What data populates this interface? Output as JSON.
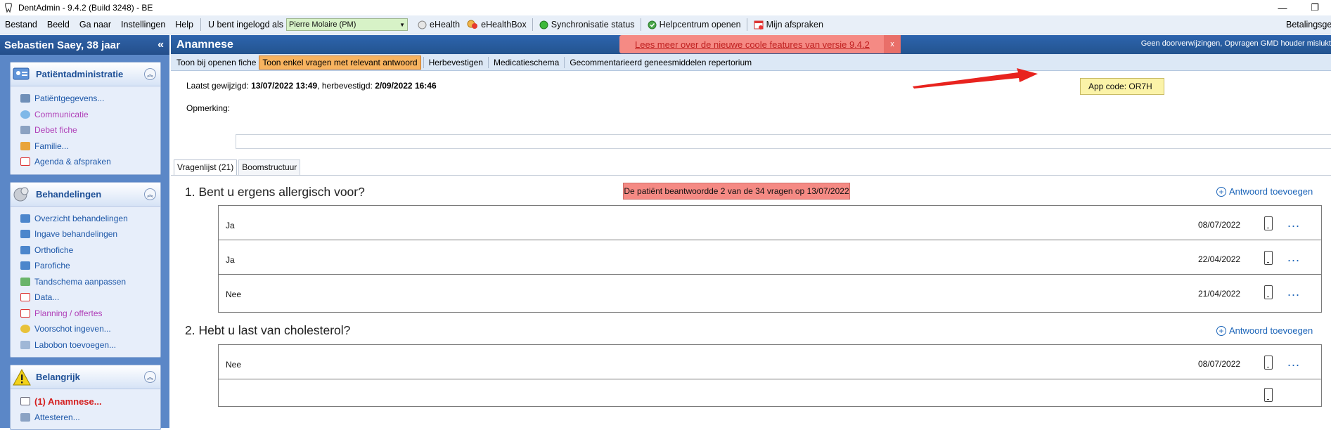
{
  "window": {
    "title": "DentAdmin - 9.4.2     (Build 3248) - BE",
    "minimize_glyph": "—",
    "restore_glyph": "❐"
  },
  "menubar": {
    "items": [
      "Bestand",
      "Beeld",
      "Ga naar",
      "Instellingen",
      "Help"
    ],
    "logged_in_label": "U bent ingelogd als",
    "user_value": "Pierre Molaire (PM)",
    "ehealth": "eHealth",
    "ehealthbox": "eHealthBox",
    "sync_status": "Synchronisatie status",
    "help_center": "Helpcentrum openen",
    "appointments": "Mijn afspraken",
    "payment_history": "Betalingsgeschiedenis"
  },
  "sidebar": {
    "patient_name": "Sebastien Saey, 38 jaar",
    "collapse_glyph": "«",
    "panels": [
      {
        "title": "Patiëntadministratie",
        "items": [
          {
            "label": "Patiëntgegevens...",
            "style": "blue"
          },
          {
            "label": "Communicatie",
            "style": "purple"
          },
          {
            "label": "Debet fiche",
            "style": "purple"
          },
          {
            "label": "Familie...",
            "style": "blue"
          },
          {
            "label": "Agenda & afspraken",
            "style": "blue"
          }
        ]
      },
      {
        "title": "Behandelingen",
        "items": [
          {
            "label": "Overzicht behandelingen",
            "style": "blue"
          },
          {
            "label": "Ingave behandelingen",
            "style": "blue"
          },
          {
            "label": "Orthofiche",
            "style": "blue"
          },
          {
            "label": "Parofiche",
            "style": "blue"
          },
          {
            "label": "Tandschema aanpassen",
            "style": "blue"
          },
          {
            "label": "Data...",
            "style": "blue"
          },
          {
            "label": "Planning / offertes",
            "style": "purple"
          },
          {
            "label": "Voorschot ingeven...",
            "style": "blue"
          },
          {
            "label": "Labobon toevoegen...",
            "style": "blue"
          }
        ]
      },
      {
        "title": "Belangrijk",
        "items": [
          {
            "label": "(1) Anamnese...",
            "style": "red"
          },
          {
            "label": "Attesteren...",
            "style": "blue"
          }
        ]
      }
    ]
  },
  "main": {
    "title": "Anamnese",
    "header_right": "Geen doorverwijzingen, Opvragen GMD houder mislukt",
    "news_banner": "Lees meer over de nieuwe coole features van versie 9.4.2",
    "news_close": "x",
    "toolbar": [
      {
        "label": "Toon bij openen fiche",
        "active": false
      },
      {
        "label": "Toon enkel vragen met relevant antwoord",
        "active": true
      },
      {
        "label": "Herbevestigen",
        "active": false
      },
      {
        "label": "Medicatieschema",
        "active": false
      },
      {
        "label": "Gecommentarieerd geneesmiddelen repertorium",
        "active": false
      }
    ],
    "last_modified_label": "Laatst gewijzigd:",
    "last_modified_value": "13/07/2022 13:49",
    "confirmed_label": "herbevestigd:",
    "confirmed_value": "2/09/2022 16:46",
    "remark_label": "Opmerking:",
    "remark_value": "",
    "app_code": "App code: OR7H",
    "tabs": [
      "Vragenlijst (21)",
      "Boomstructuur"
    ],
    "summary": "De patiënt beantwoordde 2 van de 34 vragen op 13/07/2022",
    "add_answer_label": "Antwoord toevoegen",
    "more_glyph": "...",
    "questions": [
      {
        "text": "1. Bent u ergens allergisch voor?",
        "answers": [
          {
            "answer": "Ja",
            "date": "08/07/2022"
          },
          {
            "answer": "Ja",
            "date": "22/04/2022"
          },
          {
            "answer": "Nee",
            "date": "21/04/2022"
          }
        ]
      },
      {
        "text": "2. Hebt u last van cholesterol?",
        "answers": [
          {
            "answer": "Nee",
            "date": "08/07/2022"
          }
        ]
      }
    ]
  },
  "colors": {
    "accent_blue": "#2d64ae",
    "sidebar_bg": "#5b87c7",
    "banner_red": "#f58a84",
    "active_orange": "#f8b35f",
    "link_blue": "#1b64b8",
    "app_code_yellow": "#fbf3a8",
    "arrow_red": "#e8231e"
  }
}
